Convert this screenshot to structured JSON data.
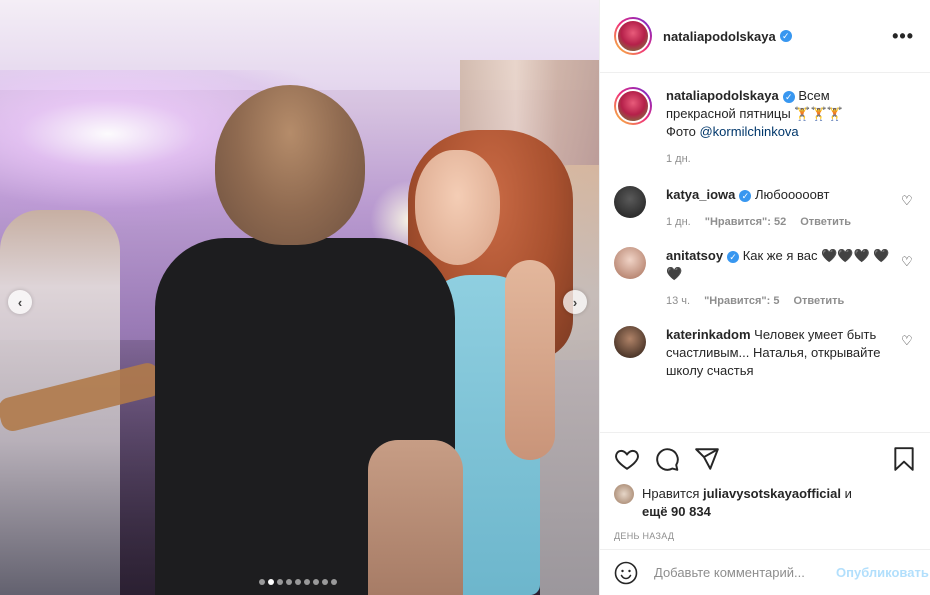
{
  "post": {
    "username": "nataliapodolskaya",
    "verified_icon": "verified-badge-icon",
    "more_icon": "more-options-icon"
  },
  "caption": {
    "username": "nataliapodolskaya",
    "text_line1": "Всем",
    "text_line2": "прекрасной пятницы 🏋🏋🏋",
    "photo_prefix": "Фото ",
    "mention": "@kormilchinkova",
    "time": "1 дн."
  },
  "comments": [
    {
      "username": "katya_iowa",
      "verified": true,
      "text": "Любооооовт",
      "time": "1 дн.",
      "likes": "\"Нравится\": 52",
      "reply": "Ответить",
      "avatar_color": "#2b2b2b"
    },
    {
      "username": "anitatsoy",
      "verified": true,
      "text": "Как же я вас 🖤🖤🖤 🖤🖤",
      "time": "13 ч.",
      "likes": "\"Нравится\": 5",
      "reply": "Ответить",
      "avatar_color": "#c79a8a"
    },
    {
      "username": "katerinkadom",
      "verified": false,
      "text": "Человек умеет быть счастливым... Наталья, открывайте школу счастья",
      "avatar_color": "#3a2a20"
    }
  ],
  "actions": {
    "icons": [
      "heart-icon",
      "comment-icon",
      "share-icon",
      "bookmark-icon"
    ]
  },
  "likes": {
    "prefix": "Нравится ",
    "user": "juliavysotskayaofficial",
    "and": " и",
    "more": "ещё 90 834"
  },
  "date": "ДЕНЬ НАЗАД",
  "add_comment": {
    "placeholder": "Добавьте комментарий...",
    "publish": "Опубликовать"
  },
  "carousel": {
    "total": 9,
    "active_index": 1
  },
  "colors": {
    "accent": "#3897f0",
    "publish_disabled": "#b2dffc",
    "muted": "#8e8e8e"
  }
}
